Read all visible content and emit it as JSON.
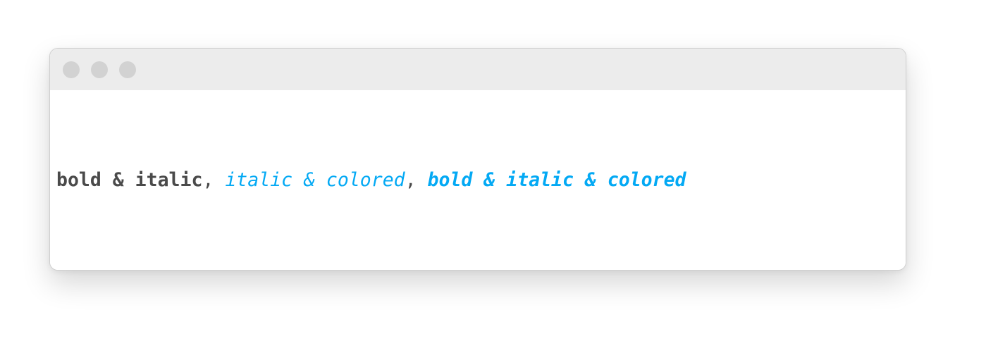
{
  "window": {
    "controls": [
      "close",
      "minimize",
      "zoom"
    ]
  },
  "colors": {
    "text": "#4a4a4a",
    "accent": "#03a9f4",
    "titlebar": "#ececec",
    "control_dot": "#d2d2d2"
  },
  "text": {
    "segment1": "bold & italic",
    "comma1": ", ",
    "segment2": "italic & colored",
    "comma2": ", ",
    "segment3": "bold & italic & colored"
  }
}
